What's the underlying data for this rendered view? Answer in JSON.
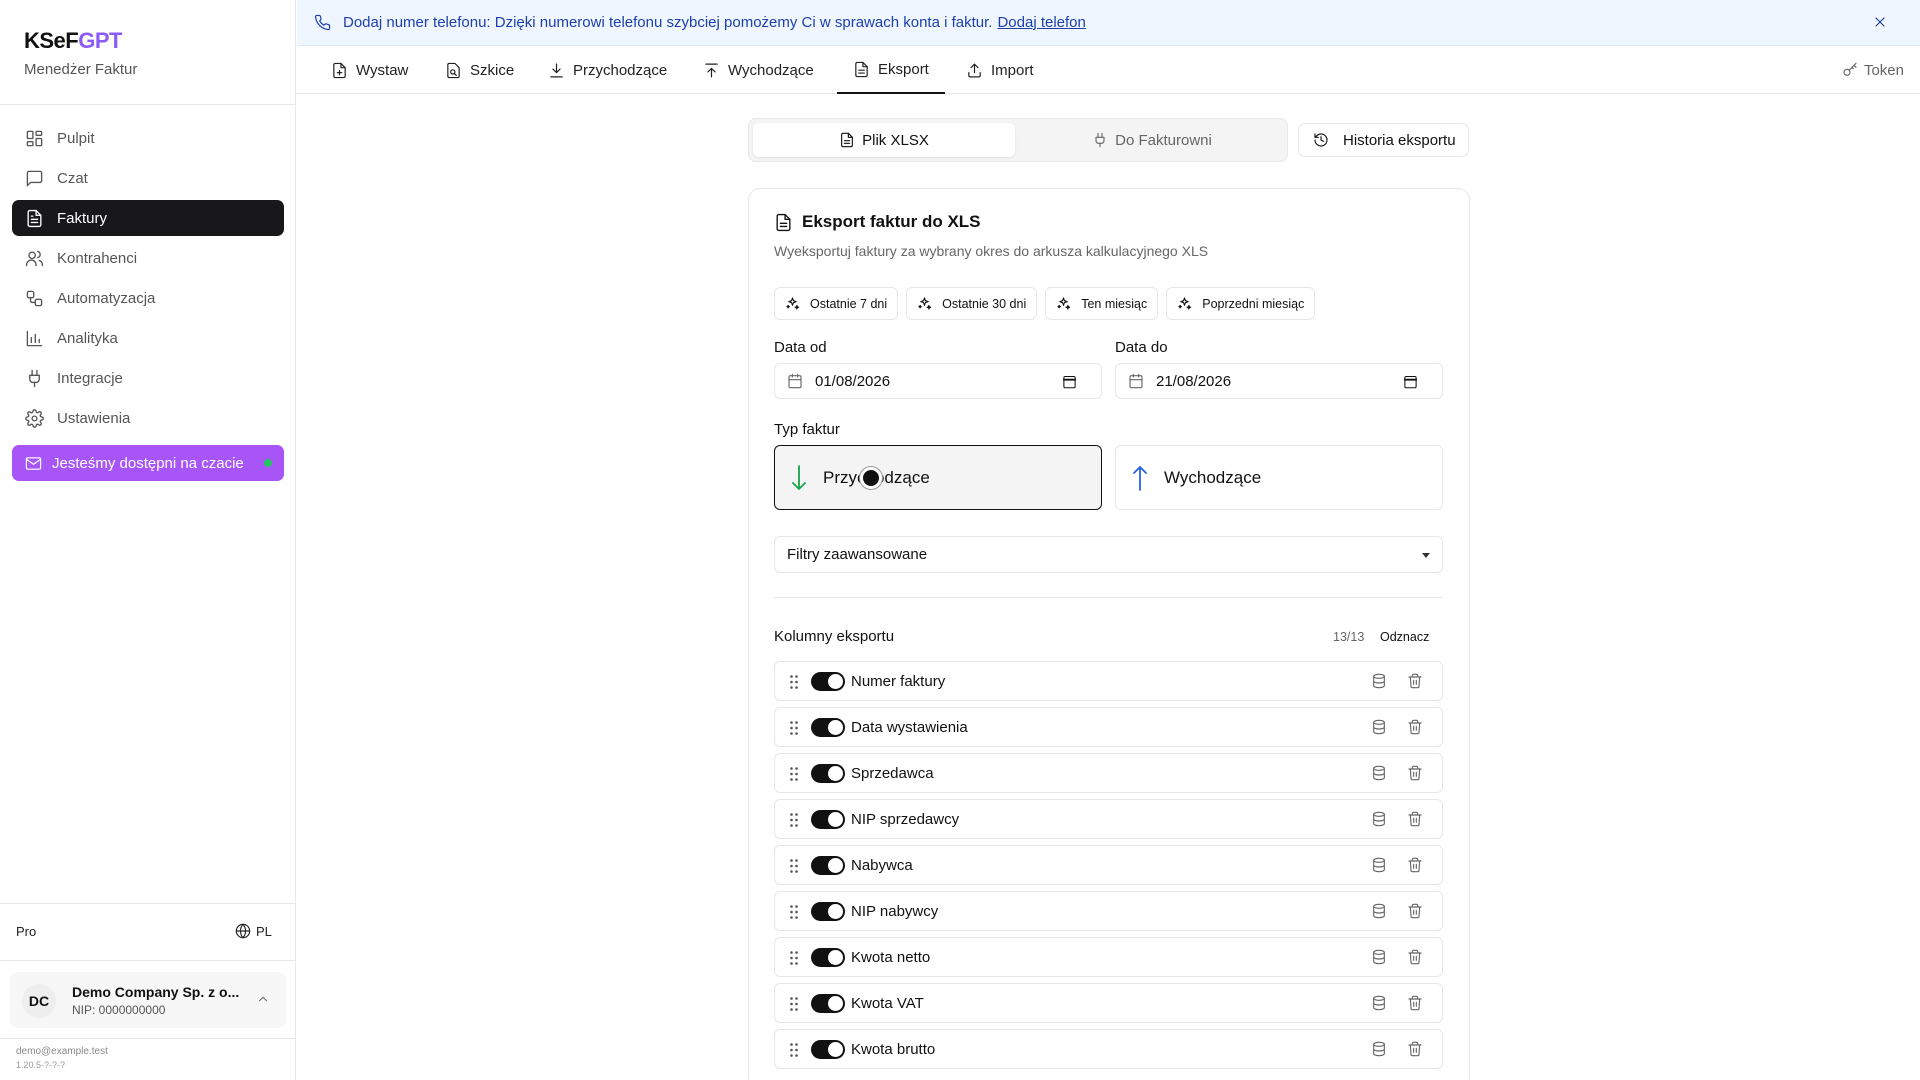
{
  "brand": {
    "name_part1": "KSeF",
    "name_part2": "GPT",
    "subtitle": "Menedżer Faktur"
  },
  "sidebar": {
    "items": [
      {
        "label": "Pulpit",
        "icon": "dashboard-icon"
      },
      {
        "label": "Czat",
        "icon": "chat-icon"
      },
      {
        "label": "Faktury",
        "icon": "invoice-icon",
        "active": true
      },
      {
        "label": "Kontrahenci",
        "icon": "users-icon"
      },
      {
        "label": "Automatyzacja",
        "icon": "workflow-icon"
      },
      {
        "label": "Analityka",
        "icon": "chart-icon"
      },
      {
        "label": "Integracje",
        "icon": "plug-icon"
      },
      {
        "label": "Ustawienia",
        "icon": "gear-icon"
      }
    ],
    "chat_pill": "Jesteśmy dostępni na czacie",
    "plan": "Pro",
    "language": "PL",
    "company": {
      "initials": "DC",
      "name": "Demo Company Sp. z o...",
      "nip": "NIP: 0000000000"
    },
    "email": "demo@example.test",
    "version": "1.20.5-?-?-?"
  },
  "banner": {
    "text": "Dodaj numer telefonu: Dzięki numerowi telefonu szybciej pomożemy Ci w sprawach konta i faktur.",
    "link": "Dodaj telefon"
  },
  "tabs": [
    {
      "label": "Wystaw",
      "icon": "file-plus-icon"
    },
    {
      "label": "Szkice",
      "icon": "draft-icon"
    },
    {
      "label": "Przychodzące",
      "icon": "download-icon"
    },
    {
      "label": "Wychodzące",
      "icon": "upload-icon"
    },
    {
      "label": "Eksport",
      "icon": "file-text-icon",
      "active": true
    },
    {
      "label": "Import",
      "icon": "import-icon"
    }
  ],
  "token_label": "Token",
  "export_mode": {
    "option_xlsx": "Plik XLSX",
    "option_fakturownia": "Do Fakturowni",
    "selected": "Plik XLSX"
  },
  "history_button": "Historia eksportu",
  "card": {
    "title": "Eksport faktur do XLS",
    "description": "Wyeksportuj faktury za wybrany okres do arkusza kalkulacyjnego XLS",
    "presets": [
      "Ostatnie 7 dni",
      "Ostatnie 30 dni",
      "Ten miesiąc",
      "Poprzedni miesiąc"
    ],
    "date_from_label": "Data od",
    "date_from": "01/08/2026",
    "date_to_label": "Data do",
    "date_to": "21/08/2026",
    "type_label": "Typ faktur",
    "type_incoming": "Przychodzące",
    "type_outgoing": "Wychodzące",
    "type_selected": "Przychodzące",
    "advanced_filters": "Filtry zaawansowane",
    "columns_title": "Kolumny eksportu",
    "columns_count": "13/13",
    "columns_toggle": "Odznacz",
    "columns": [
      "Numer faktury",
      "Data wystawienia",
      "Sprzedawca",
      "NIP sprzedawcy",
      "Nabywca",
      "NIP nabywcy",
      "Kwota netto",
      "Kwota VAT",
      "Kwota brutto"
    ]
  },
  "colors": {
    "accent": "#a855f7",
    "brand_gpt": "#8b5cf6",
    "active_nav": "#18181b",
    "incoming_arrow": "#16a34a",
    "outgoing_arrow": "#2563eb",
    "banner_bg": "#eff6ff"
  }
}
